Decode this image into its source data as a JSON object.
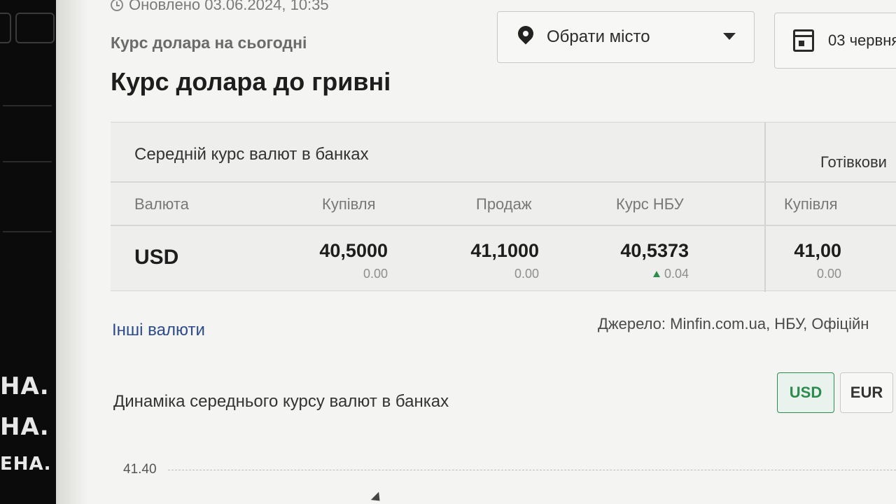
{
  "background_strip": {
    "edge_lines": [
      "НА.",
      "НА.",
      "ЕНА."
    ]
  },
  "header": {
    "updated": "Оновлено 03.06.2024, 10:35",
    "subtitle": "Курс долара на сьогодні",
    "title": "Курс долара до гривні"
  },
  "filters": {
    "city": {
      "label": "Обрати місто",
      "icon": "map-pin-icon"
    },
    "date": {
      "label": "03 червня",
      "icon": "calendar-icon"
    }
  },
  "rates_table": {
    "group_banks": "Середній курс валют в банках",
    "group_cash": "Готівкови",
    "headers": [
      "Валюта",
      "Купівля",
      "Продаж",
      "Курс НБУ",
      "Купівля"
    ],
    "row": {
      "currency": "USD",
      "buy": "40,5000",
      "buy_change": "0.00",
      "sell": "41,1000",
      "sell_change": "0.00",
      "nbu": "40,5373",
      "nbu_change": "0.04",
      "nbu_change_direction": "up",
      "cash_buy": "41,00",
      "cash_buy_change": "0.00"
    }
  },
  "other_currencies_link": "Інші валюти",
  "source": "Джерело: Minfin.com.ua, НБУ, Офіційн",
  "chart": {
    "title": "Динаміка середнього курсу валют в банках",
    "currency_buttons": [
      {
        "label": "USD",
        "active": true
      },
      {
        "label": "EUR",
        "active": false
      }
    ],
    "y_tick": "41.40"
  },
  "colors": {
    "accent_green": "#2e8b4e",
    "link_blue": "#2d4b8c"
  }
}
